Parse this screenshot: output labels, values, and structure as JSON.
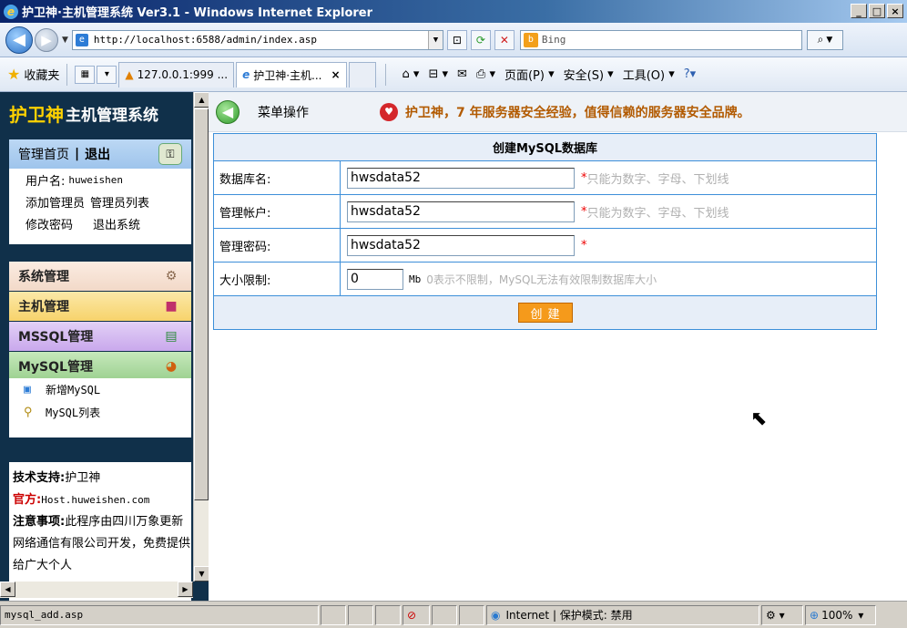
{
  "window": {
    "title": "护卫神·主机管理系统 Ver3.1 - Windows Internet Explorer",
    "minimize": "_",
    "maximize": "□",
    "close": "×"
  },
  "browser": {
    "url": "http://localhost:6588/admin/index.asp",
    "search_provider": "Bing",
    "favorites_label": "收藏夹",
    "tabs": [
      {
        "label": "127.0.0.1:999 ...",
        "active": false
      },
      {
        "label": "护卫神·主机...",
        "active": true
      }
    ],
    "tab_close": "×",
    "commands": {
      "page": "页面(P)",
      "safety": "安全(S)",
      "tools": "工具(O)"
    }
  },
  "sidebar": {
    "brand_highlight": "护卫神",
    "brand_rest": "主机管理系统",
    "nav_home": "管理首页",
    "nav_sep": "|",
    "nav_logout": "退出",
    "username_label": "用户名:",
    "username": "huweishen",
    "links_row1": [
      "添加管理员",
      "管理员列表"
    ],
    "links_row2": [
      "修改密码",
      "退出系统"
    ],
    "menus": [
      {
        "label": "系统管理",
        "color": "#f2d9c8",
        "icon": "gear-icon"
      },
      {
        "label": "主机管理",
        "color": "#f7d36b",
        "icon": "host-icon"
      },
      {
        "label": "MSSQL管理",
        "color": "#c9a8ec",
        "icon": "mssql-icon"
      },
      {
        "label": "MySQL管理",
        "color": "#9bd08f",
        "icon": "mysql-icon"
      }
    ],
    "submenu": [
      {
        "label": "新增MySQL",
        "icon": "add-db-icon"
      },
      {
        "label": "MySQL列表",
        "icon": "search-icon"
      }
    ],
    "support_label": "技术支持:",
    "support_value": "护卫神",
    "site_label": "官方:",
    "site_value": "Host.huweishen.com",
    "notice_label": "注意事项:",
    "notice_text": "此程序由四川万象更新网络通信有限公司开发，免费提供给广大个人"
  },
  "main": {
    "op_label": "菜单操作",
    "slogan": "护卫神，7 年服务器安全经验，值得信赖的服务器安全品牌。",
    "form_title": "创建MySQL数据库",
    "fields": [
      {
        "label": "数据库名:",
        "value": "hwsdata52",
        "required": "*",
        "hint": "只能为数字、字母、下划线"
      },
      {
        "label": "管理帐户:",
        "value": "hwsdata52",
        "required": "*",
        "hint": "只能为数字、字母、下划线"
      },
      {
        "label": "管理密码:",
        "value": "hwsdata52",
        "required": "*",
        "hint": ""
      }
    ],
    "size_label": "大小限制:",
    "size_value": "0",
    "size_unit": "Mb",
    "size_hint": "0表示不限制，MySQL无法有效限制数据库大小",
    "create_button": "创建"
  },
  "status": {
    "left": "mysql_add.asp",
    "zone": "Internet | 保护模式: 禁用",
    "zoom": "100%"
  }
}
